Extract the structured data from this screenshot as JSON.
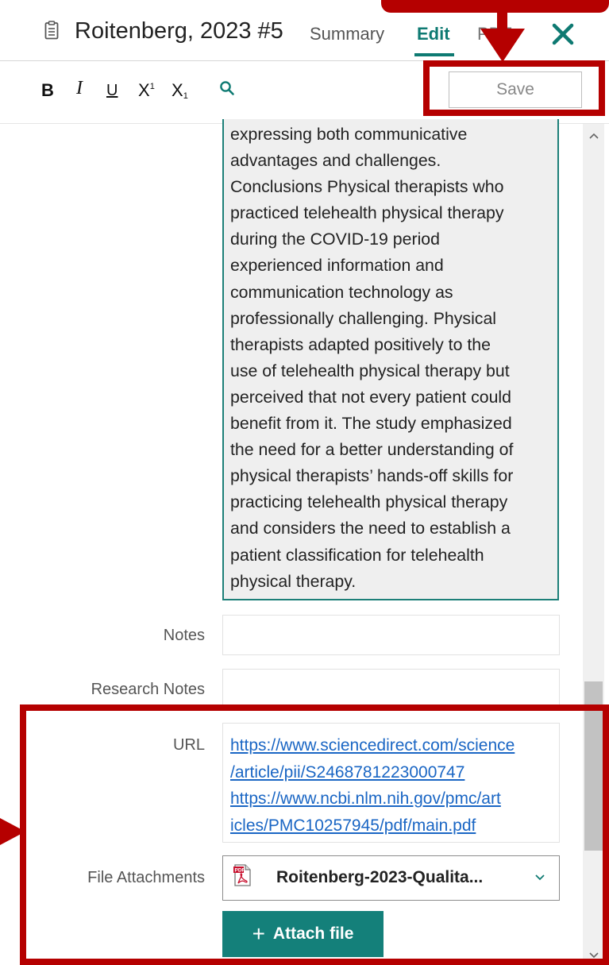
{
  "header": {
    "title": "Roitenberg, 2023 #5",
    "tabs": [
      {
        "label": "Summary"
      },
      {
        "label": "Edit"
      },
      {
        "label": "PDF"
      }
    ]
  },
  "toolbar": {
    "bold": "B",
    "italic": "I",
    "underline": "U",
    "superscript": "X",
    "superscript_mark": "1",
    "subscript": "X",
    "subscript_mark": "1",
    "save_label": "Save"
  },
  "abstract": {
    "lines": [
      "expressing both communicative",
      "advantages and challenges.",
      "Conclusions Physical therapists who",
      "practiced telehealth physical therapy",
      "during the COVID-19 period",
      "experienced information and",
      "communication technology as",
      "professionally challenging. Physical",
      "therapists adapted positively to the",
      "use of telehealth physical therapy but",
      "perceived that not every patient could",
      "benefit from it. The study emphasized",
      "the need for a better understanding of",
      "physical therapists’ hands-off skills for",
      "practicing telehealth physical therapy",
      "and considers the need to establish a",
      "patient classification for telehealth",
      "physical therapy."
    ]
  },
  "fields": {
    "notes_label": "Notes",
    "notes_value": "",
    "research_notes_label": "Research Notes",
    "research_notes_value": "",
    "url_label": "URL",
    "url_lines": [
      "https://www.sciencedirect.com/science",
      "/article/pii/S2468781223000747",
      "https://www.ncbi.nlm.nih.gov/pmc/art",
      "icles/PMC10257945/pdf/main.pdf"
    ],
    "attachments_label": "File Attachments",
    "attachment_name": "Roitenberg-2023-Qualita...",
    "attach_button_label": "Attach file"
  },
  "icons": {
    "clipboard": "clipboard-icon",
    "close": "close-icon",
    "search": "search-icon",
    "pdf": "pdf-file-icon",
    "chevron": "chevron-down-icon",
    "plus": "plus-icon"
  },
  "colors": {
    "accent": "#0e7a72",
    "annotation_red": "#b50000",
    "link": "#1a66c4"
  }
}
